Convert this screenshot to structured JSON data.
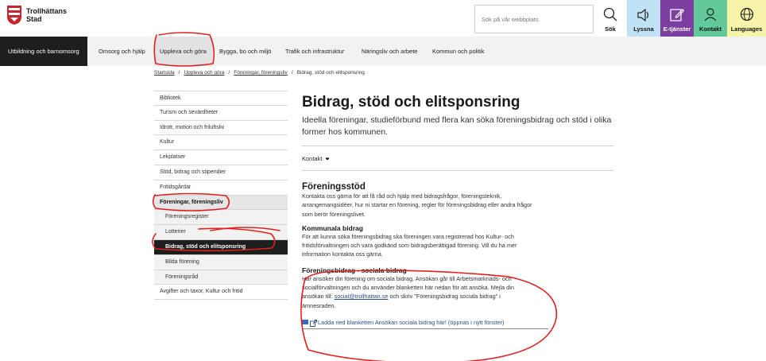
{
  "header": {
    "logo_line1": "Trollhättans",
    "logo_line2": "Stad",
    "search_placeholder": "Sök på vår webbplats",
    "tools": {
      "search": "Sök",
      "listen": "Lyssna",
      "eservices": "E-tjänster",
      "contact": "Kontakt",
      "languages": "Languages"
    }
  },
  "nav": {
    "items": [
      "Utbildning och barnomsorg",
      "Omsorg och hjälp",
      "Uppleva och göra",
      "Bygga, bo och miljö",
      "Trafik och infrastruktur",
      "Näringsliv och arbete",
      "Kommun och politik"
    ]
  },
  "breadcrumb": {
    "items": [
      "Startsida",
      "Uppleva och göra",
      "Föreningar, föreningsliv",
      "Bidrag, stöd och elitsponsring"
    ]
  },
  "sidebar": {
    "items": [
      "Bibliotek",
      "Turism och sevärdheter",
      "Idrott, motion och friluftsliv",
      "Kultur",
      "Lekplatser",
      "Stöd, bidrag och stipendier",
      "Fritidsgårdar",
      "Föreningar, föreningsliv",
      "Föreningsregister",
      "Lotterier",
      "Bidrag, stöd och elitsponsring",
      "Bilda förening",
      "Föreningsråd",
      "Avgifter och taxor, Kultur och fritid"
    ]
  },
  "main": {
    "title": "Bidrag, stöd och elitsponsring",
    "lead": "Ideella föreningar, studieförbund med flera kan söka föreningsbidrag och stöd i olika former hos kommunen.",
    "contact_label": "Kontakt",
    "contact_chevron": "❤",
    "s1_title": "Föreningsstöd",
    "s1_text": "Kontakta oss gärna för att få råd och hjälp med bidragsfrågor, föreningsteknik, arrangemangsidéer, hur ni startar en förening, regler för föreningsbidrag eller andra frågor som berör föreningslivet.",
    "s2_title": "Kommunala bidrag",
    "s2_text": "För att kunna söka föreningsbidrag ska föreningen vara registrerad hos Kultur- och fritidsförvaltningen och vara godkänd som bidragsberättigad förening. Vill du ha mer information kontakta oss gärna.",
    "s3_title": "Föreningsbidrag - sociala bidrag",
    "s3_text_before": "Här ansöker din förening om sociala bidrag. Ansökan går till Arbetsmarknads- och socialförvaltningen och du använder blanketten här nedan för att ansöka. Mejla din ansökan till:",
    "s3_email": "social@trollhattan.se",
    "s3_text_after": "och skriv \"Föreningsbidrag  sociala bidrag\" i ämnesraden.",
    "download_link": "Ladda ned blanketten Ansökan sociala bidrag här! (öppnas i nytt fönster)"
  },
  "colors": {
    "nav_active": "#1e1e1e",
    "lyssna": "#bfe3f5",
    "etjanster": "#7b3fa0",
    "kontakt": "#62c99a",
    "languages": "#f6f4a8",
    "annotation": "#e02020"
  }
}
